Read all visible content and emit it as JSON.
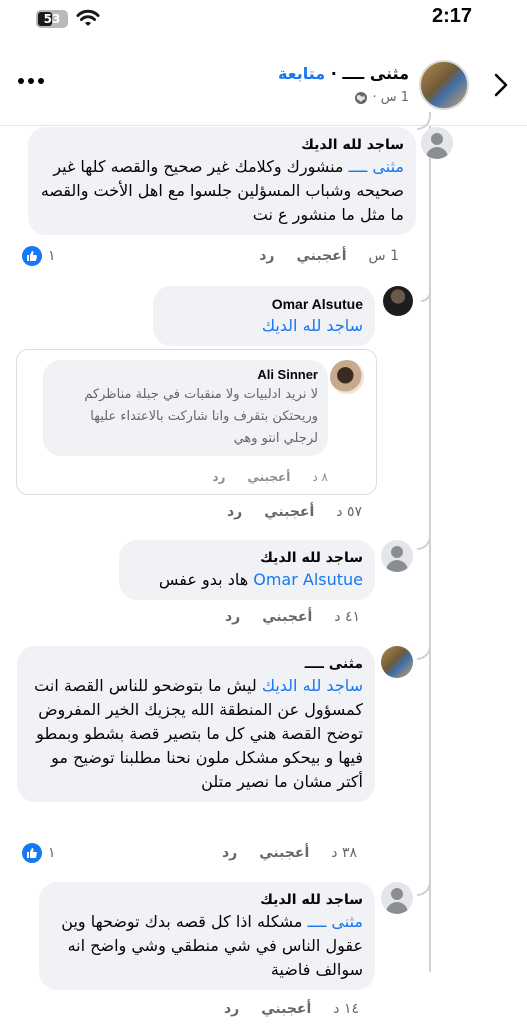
{
  "status_bar": {
    "battery": "53",
    "time": "2:17"
  },
  "header": {
    "name": "مثنى ــــ",
    "separator": "·",
    "follow_label": "متابعة",
    "meta": "1 س ·",
    "globe_icon": "globe-icon",
    "back_icon": "chevron-right-icon",
    "more_icon": "more-dots-icon"
  },
  "comments": [
    {
      "author": "ساجد لله الديك",
      "mention": "مثنى ــــ",
      "text": " منشورك وكلامك غير صحيح والقصه كلها غير صحيحه وشباب المسؤلين جلسوا مع اهل الأخت والقصه ما مثل ما منشور ع نت",
      "age": "1 س",
      "like_label": "أعجبني",
      "reply_label": "رد",
      "likes": "١"
    },
    {
      "author": "Omar Alsutue",
      "mention": "ساجد لله الديك",
      "text": "",
      "age": "٥٧ د",
      "like_label": "أعجبني",
      "reply_label": "رد",
      "shared": {
        "author": "Ali Sinner",
        "text": "لا نريد ادلبيات ولا منقبات في جبلة مناظركم وريحتكن بتقرف وانا شاركت بالاعتداء عليها لرجلي انتو وهي",
        "age": "٨ د",
        "like_label": "أعجبني",
        "reply_label": "رد"
      }
    },
    {
      "author": "ساجد لله الديك",
      "mention": "Omar Alsutue",
      "text": " هاد بدو عفس",
      "age": "٤١ د",
      "like_label": "أعجبني",
      "reply_label": "رد"
    },
    {
      "author": "مثنى ــــ",
      "mention": "ساجد لله الديك",
      "text": " ليش ما بتوضحو للناس القصة انت كمسؤول عن المنطقة الله يجزيك الخير المفروض توضح القصة  هني كل ما بتصير قصة بشطو وبمطو فيها و بيحكو مشكل ملون نحنا مطلبنا توضيح مو أكتر مشان ما نصير متلن",
      "age": "٣٨ د",
      "like_label": "أعجبني",
      "reply_label": "رد",
      "likes": "١"
    },
    {
      "author": "ساجد لله الديك",
      "mention": "مثنى ــــ",
      "text": " مشكله اذا كل قصه بدك توضحها وين عقول الناس في شي منطقي وشي واضح انه سوالف فاضية",
      "age": "١٤ د",
      "like_label": "أعجبني",
      "reply_label": "رد"
    }
  ]
}
